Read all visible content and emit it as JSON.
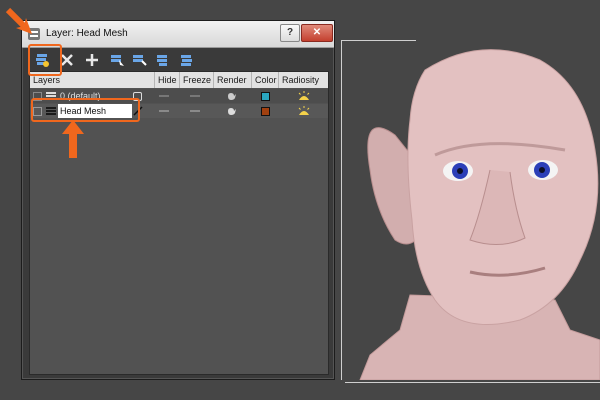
{
  "window": {
    "title": "Layer: Head Mesh",
    "help_label": "?",
    "close_label": "✕"
  },
  "toolbar": {
    "icons": [
      "create-layer-icon",
      "delete-layer-icon",
      "add-to-layer-icon",
      "select-in-layer-icon",
      "highlight-layer-icon",
      "hide-freeze-icon",
      "layer-properties-icon"
    ]
  },
  "columns": {
    "layers": "Layers",
    "hide": "Hide",
    "freeze": "Freeze",
    "render": "Render",
    "color": "Color",
    "radiosity": "Radiosity"
  },
  "rows": [
    {
      "name": "0 (default)",
      "color": "#2aa6c0"
    },
    {
      "name": "Head Mesh",
      "color": "#a0400f"
    }
  ],
  "accent_color": "#f0671d"
}
